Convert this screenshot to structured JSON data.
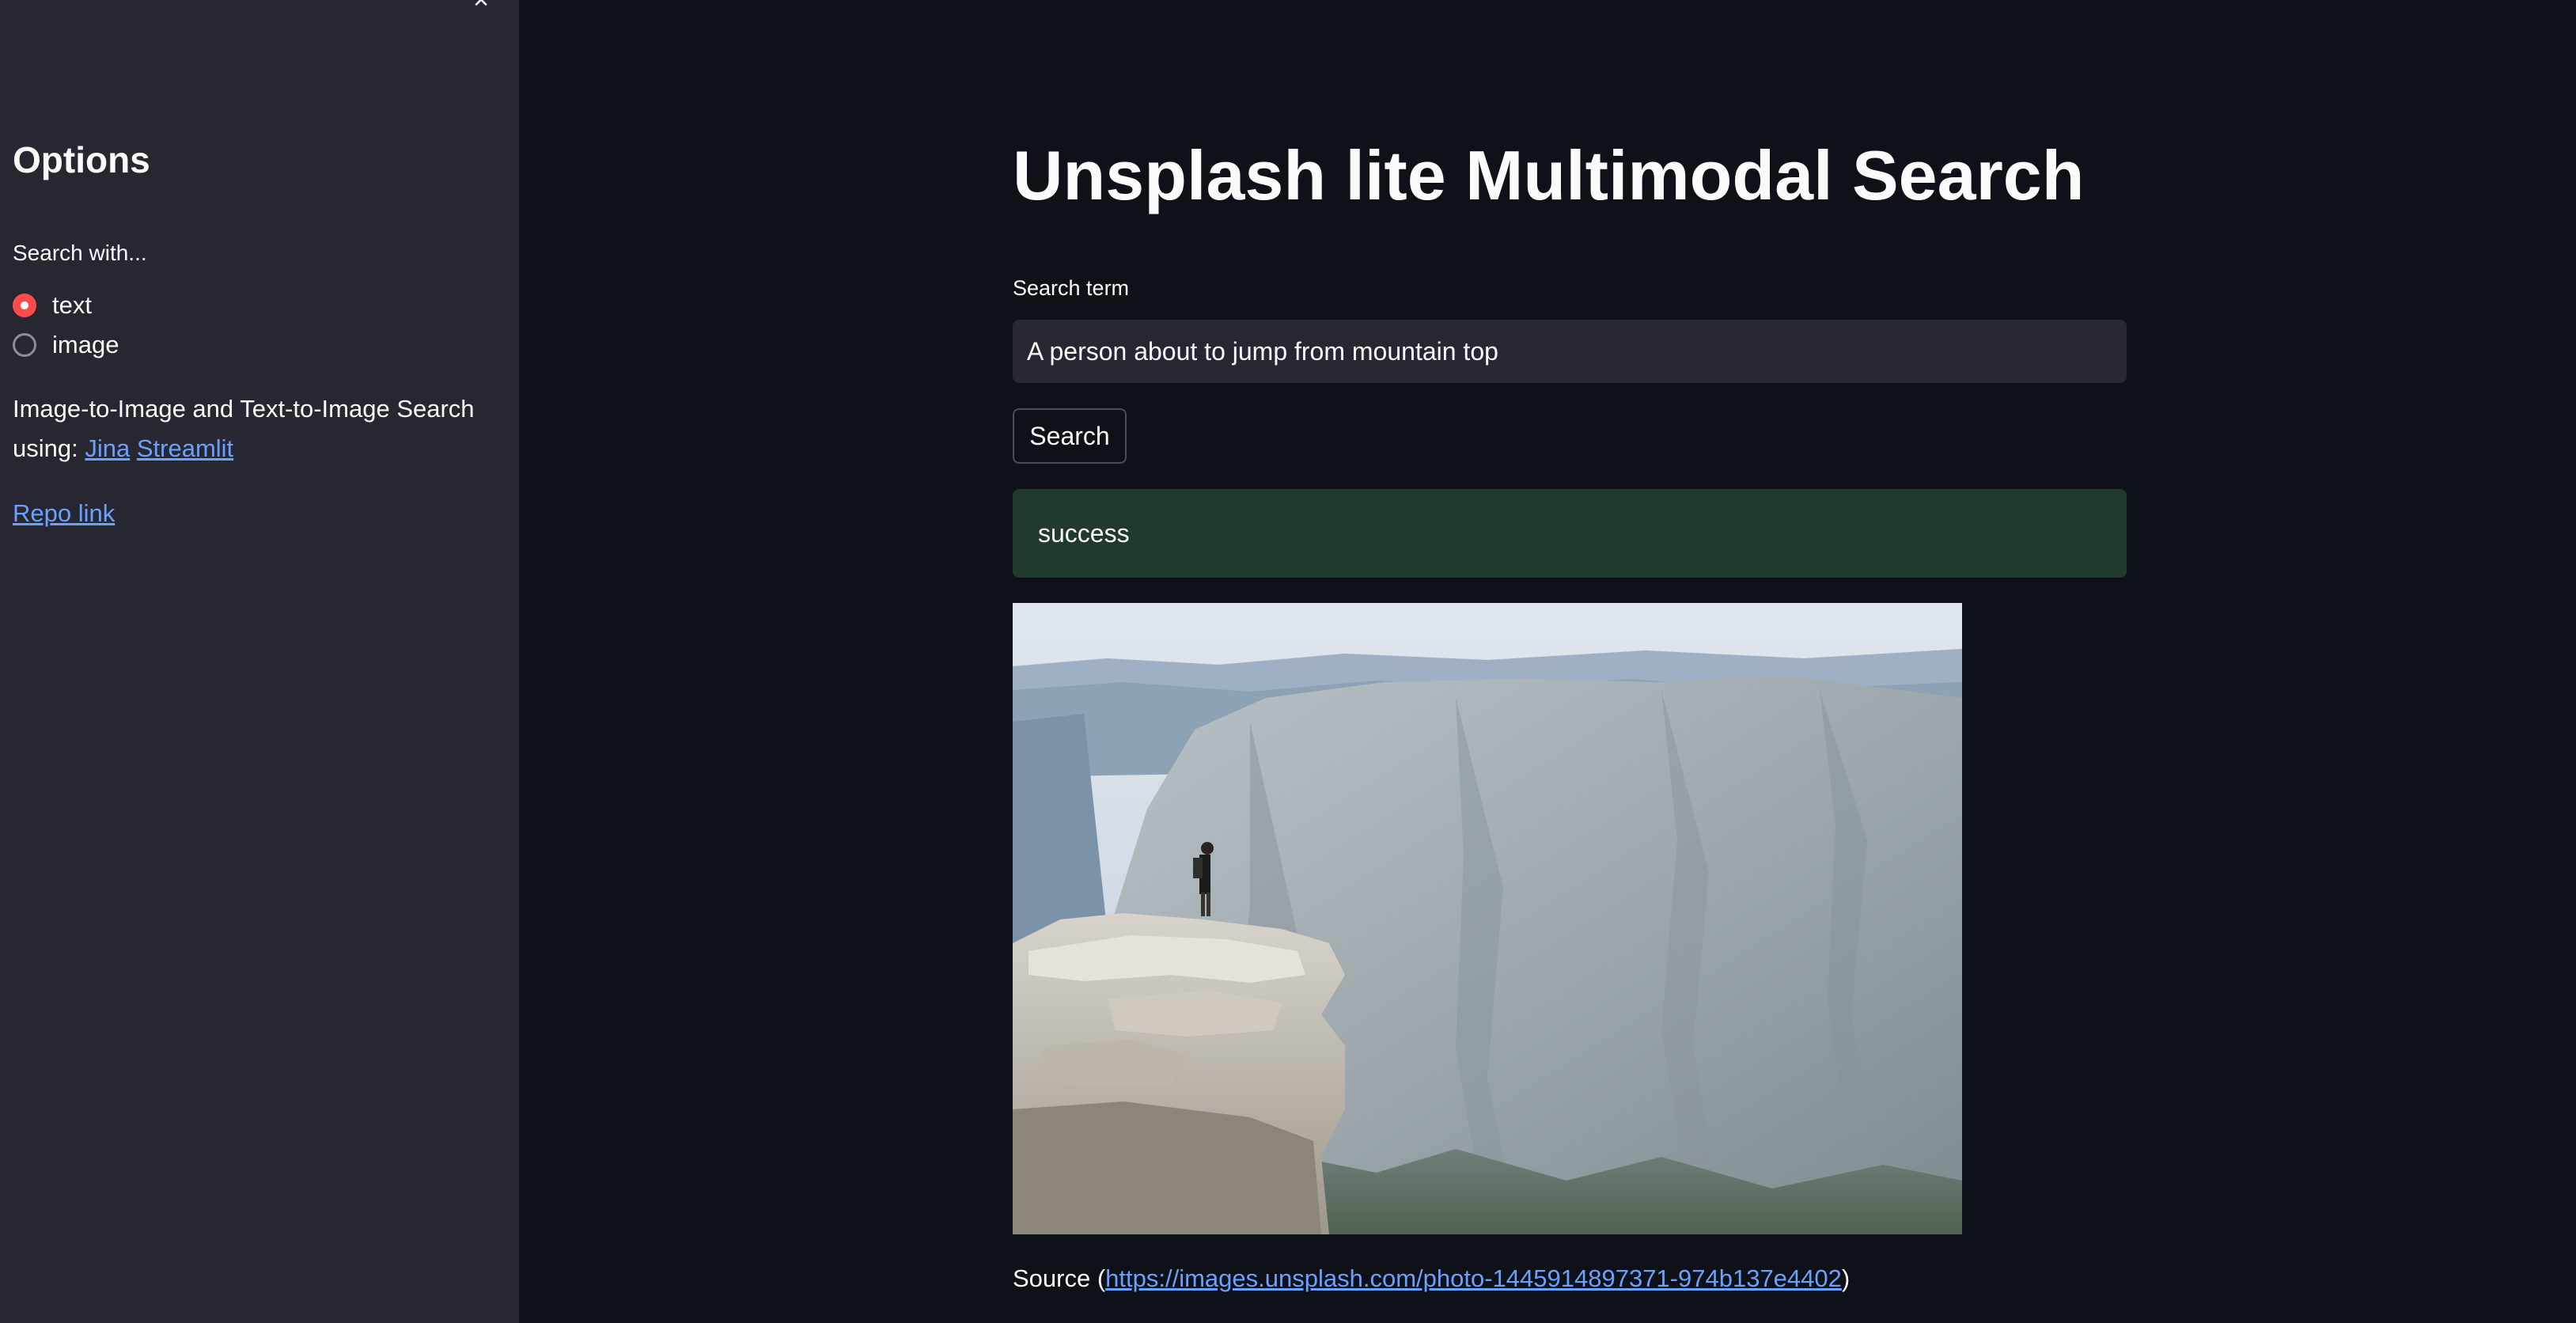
{
  "sidebar": {
    "close_glyph": "×",
    "title": "Options",
    "radio_group_label": "Search with...",
    "radio_options": [
      {
        "label": "text",
        "checked": true
      },
      {
        "label": "image",
        "checked": false
      }
    ],
    "description_prefix": "Image-to-Image and Text-to-Image Search using:",
    "link_jina": "Jina",
    "link_streamlit": "Streamlit",
    "repo_link": "Repo link"
  },
  "main": {
    "title": "Unsplash lite Multimodal Search",
    "search_label": "Search term",
    "search_value": "A person about to jump from mountain top",
    "search_button": "Search",
    "status_message": "success",
    "result": {
      "caption_prefix": "Source (",
      "caption_link": "https://images.unsplash.com/photo-1445914897371-974b137e4402",
      "caption_suffix": ")"
    }
  },
  "colors": {
    "background": "#0e1117",
    "sidebar": "#262730",
    "accent": "#ff4b4b",
    "link": "#6aa0ff",
    "success_bg": "#203a2c"
  },
  "icons": {
    "close": "close-icon",
    "radio_checked": "radio-checked-icon",
    "radio_unchecked": "radio-unchecked-icon"
  }
}
